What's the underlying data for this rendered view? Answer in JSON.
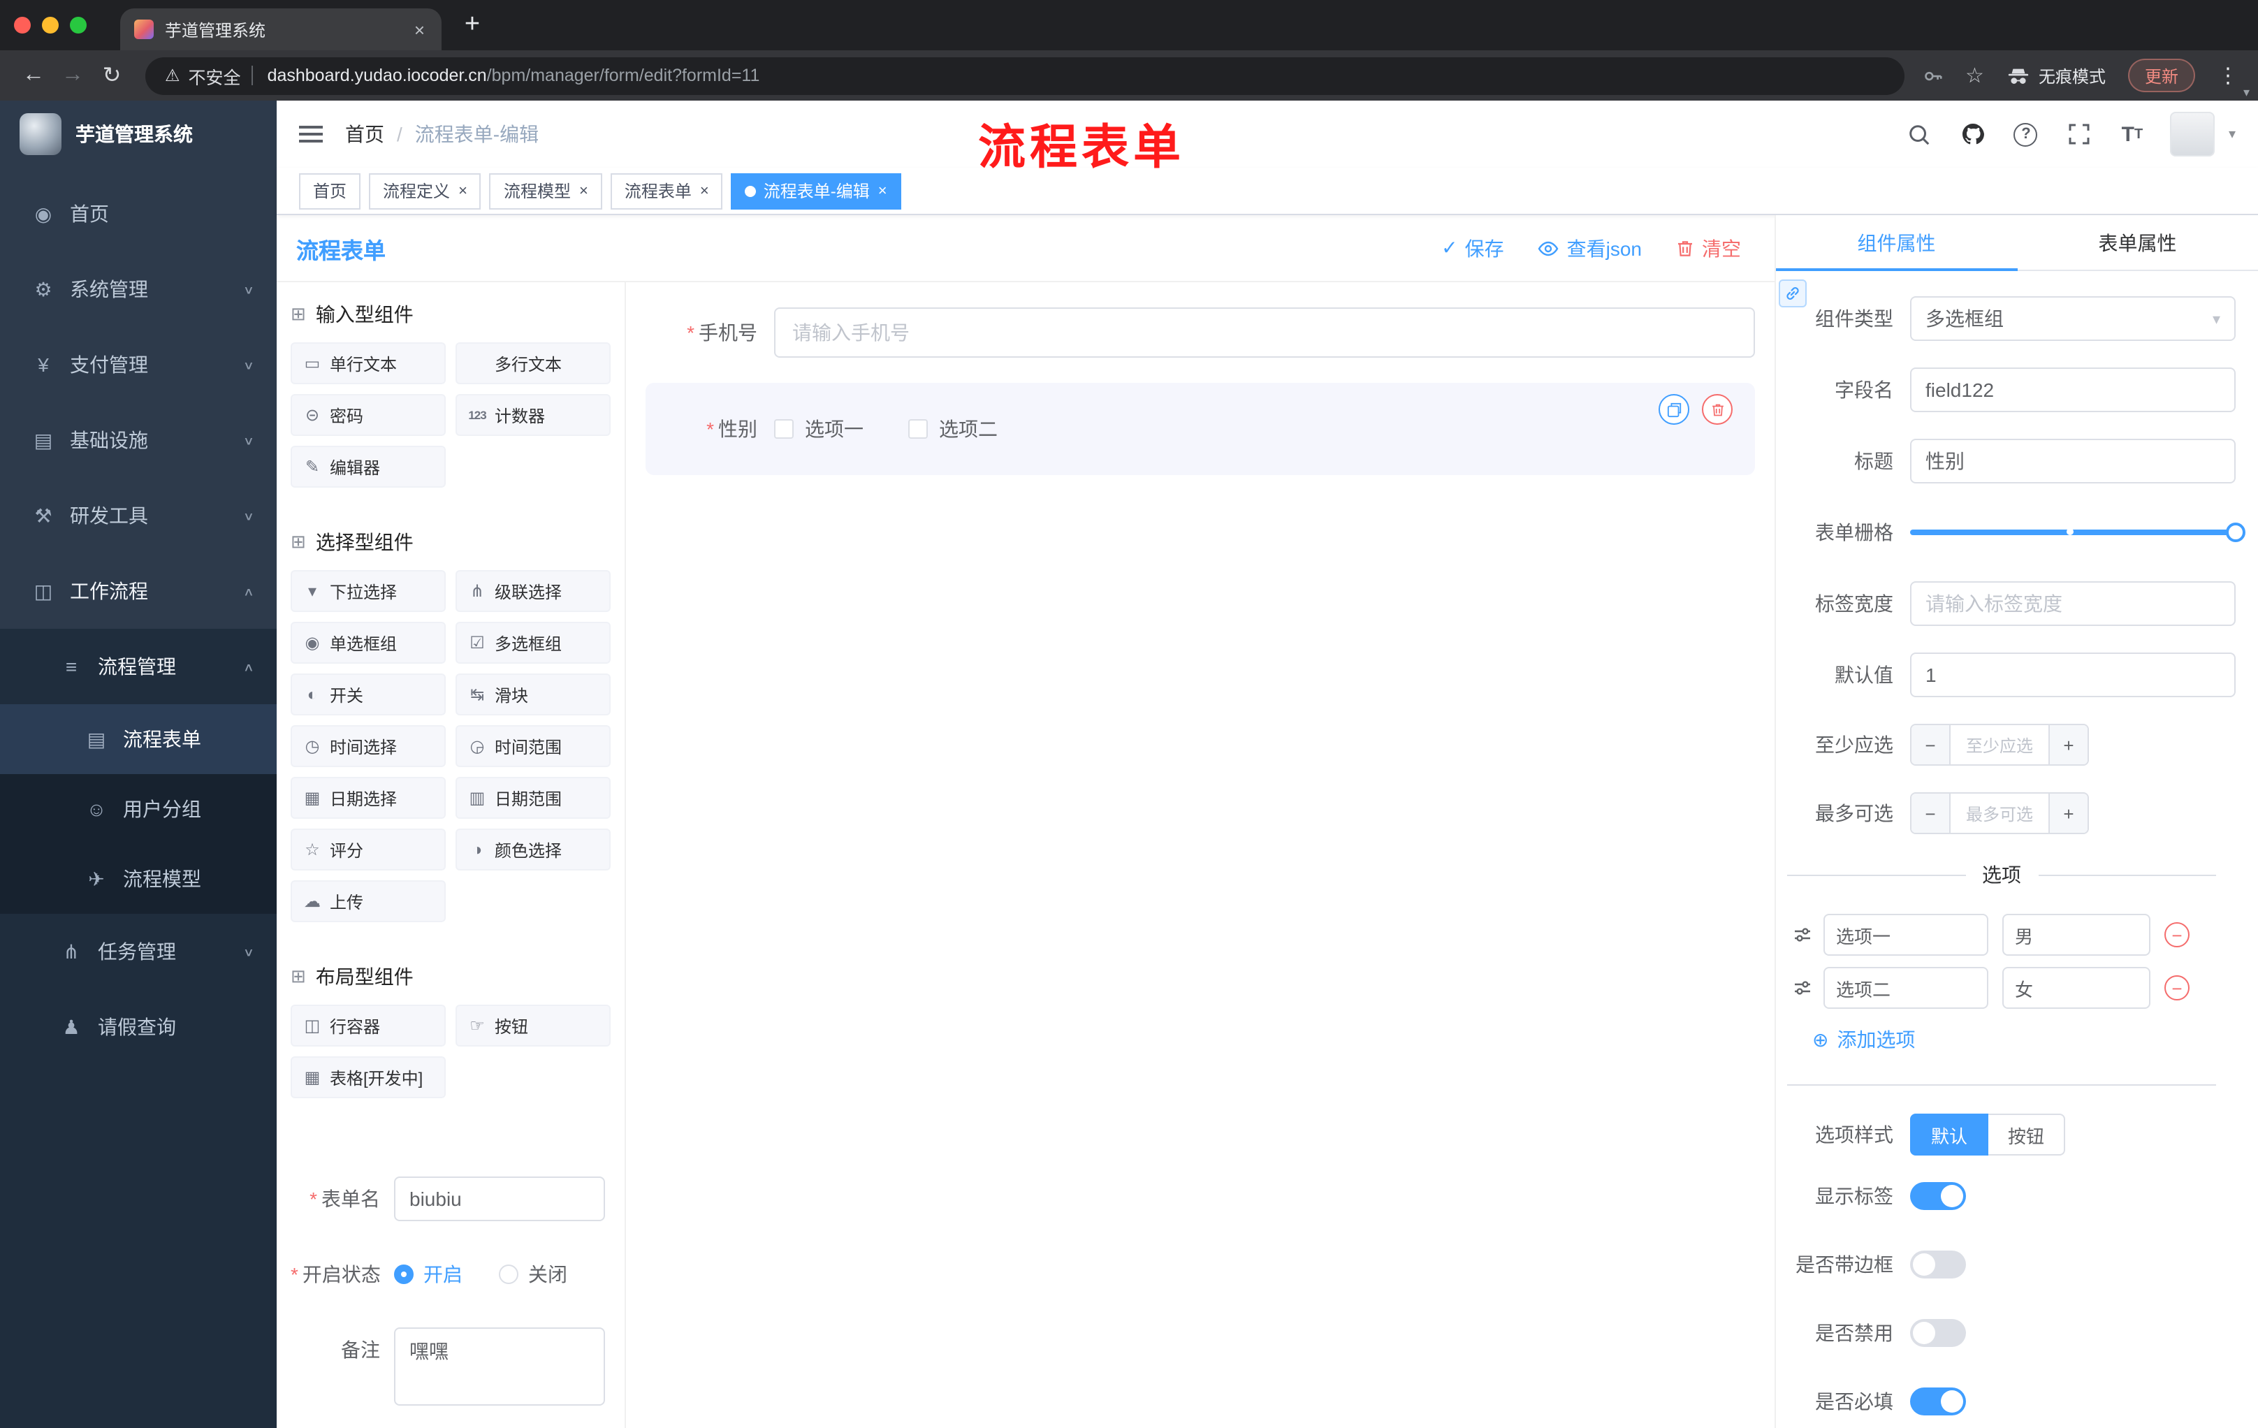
{
  "browser": {
    "tab_title": "芋道管理系统",
    "security_label": "不安全",
    "url_domain": "dashboard.yudao.iocoder.cn",
    "url_path": "/bpm/manager/form/edit?formId=11",
    "incognito_label": "无痕模式",
    "update_label": "更新"
  },
  "icons": {
    "required": "*",
    "close": "×",
    "plus": "+",
    "minus": "−",
    "add": "⊕",
    "check": "✓",
    "caret_down": "▾",
    "back": "←",
    "forward": "→",
    "reload": "↻",
    "warning": "⚠",
    "star": "☆",
    "dots": "⋮",
    "question": "?",
    "font_large": "T",
    "font_small": "T",
    "section": "⊞"
  },
  "annotation_text": "流程表单",
  "sidebar": {
    "logo_title": "芋道管理系统",
    "items": [
      {
        "label": "首页",
        "icon": "◉"
      },
      {
        "label": "系统管理",
        "icon": "⚙",
        "chevron": "∨"
      },
      {
        "label": "支付管理",
        "icon": "¥",
        "chevron": "∨"
      },
      {
        "label": "基础设施",
        "icon": "▤",
        "chevron": "∨"
      },
      {
        "label": "研发工具",
        "icon": "⚒",
        "chevron": "∨"
      },
      {
        "label": "工作流程",
        "icon": "◫",
        "chevron": "∧"
      },
      {
        "label": "流程管理",
        "icon": "≡",
        "chevron": "∧"
      },
      {
        "label": "流程表单",
        "icon": "▤"
      },
      {
        "label": "用户分组",
        "icon": "☺"
      },
      {
        "label": "流程模型",
        "icon": "✈"
      },
      {
        "label": "任务管理",
        "icon": "⋔",
        "chevron": "∨"
      },
      {
        "label": "请假查询",
        "icon": "♟"
      }
    ]
  },
  "topbar": {
    "breadcrumb_home": "首页",
    "breadcrumb_sep": "/",
    "breadcrumb_current": "流程表单-编辑"
  },
  "tags": [
    {
      "label": "首页"
    },
    {
      "label": "流程定义"
    },
    {
      "label": "流程模型"
    },
    {
      "label": "流程表单"
    },
    {
      "label": "流程表单-编辑"
    }
  ],
  "designer": {
    "title": "流程表单",
    "save": "保存",
    "view_json": "查看json",
    "clear": "清空",
    "sections": [
      {
        "title": "输入型组件",
        "items": [
          {
            "label": "单行文本",
            "icon": "▭"
          },
          {
            "label": "多行文本",
            "icon": "≡"
          },
          {
            "label": "密码",
            "icon": "⊝"
          },
          {
            "label": "计数器",
            "icon": "123"
          },
          {
            "label": "编辑器",
            "icon": "✎"
          }
        ]
      },
      {
        "title": "选择型组件",
        "items": [
          {
            "label": "下拉选择",
            "icon": "▾"
          },
          {
            "label": "级联选择",
            "icon": "⋔"
          },
          {
            "label": "单选框组",
            "icon": "◉"
          },
          {
            "label": "多选框组",
            "icon": "☑"
          },
          {
            "label": "开关",
            "icon": "◐"
          },
          {
            "label": "滑块",
            "icon": "↹"
          },
          {
            "label": "时间选择",
            "icon": "◷"
          },
          {
            "label": "时间范围",
            "icon": "◶"
          },
          {
            "label": "日期选择",
            "icon": "▦"
          },
          {
            "label": "日期范围",
            "icon": "▥"
          },
          {
            "label": "评分",
            "icon": "☆"
          },
          {
            "label": "颜色选择",
            "icon": "◑"
          },
          {
            "label": "上传",
            "icon": "☁"
          }
        ]
      },
      {
        "title": "布局型组件",
        "items": [
          {
            "label": "行容器",
            "icon": "◫"
          },
          {
            "label": "按钮",
            "icon": "☞"
          },
          {
            "label": "表格[开发中]",
            "icon": "▦"
          }
        ]
      }
    ],
    "meta": {
      "name_label": "表单名",
      "name_value": "biubiu",
      "status_label": "开启状态",
      "status_on": "开启",
      "status_off": "关闭",
      "remark_label": "备注",
      "remark_value": "嘿嘿"
    },
    "canvas": {
      "phone_label": "手机号",
      "phone_placeholder": "请输入手机号",
      "gender_label": "性别",
      "gender_options": [
        "选项一",
        "选项二"
      ]
    }
  },
  "props": {
    "tab_component": "组件属性",
    "tab_form": "表单属性",
    "component_type_label": "组件类型",
    "component_type_value": "多选框组",
    "field_name_label": "字段名",
    "field_name_value": "field122",
    "title_label": "标题",
    "title_value": "性别",
    "grid_label": "表单栅格",
    "label_width_label": "标签宽度",
    "label_width_placeholder": "请输入标签宽度",
    "default_label": "默认值",
    "default_value": "1",
    "min_label": "至少应选",
    "min_placeholder": "至少应选",
    "max_label": "最多可选",
    "max_placeholder": "最多可选",
    "options_title": "选项",
    "options": [
      {
        "label": "选项一",
        "value": "男"
      },
      {
        "label": "选项二",
        "value": "女"
      }
    ],
    "add_option": "添加选项",
    "style_label": "选项样式",
    "style_default": "默认",
    "style_button": "按钮",
    "switches": [
      {
        "label": "显示标签",
        "on": true
      },
      {
        "label": "是否带边框",
        "on": false
      },
      {
        "label": "是否禁用",
        "on": false
      },
      {
        "label": "是否必填",
        "on": true
      }
    ]
  }
}
